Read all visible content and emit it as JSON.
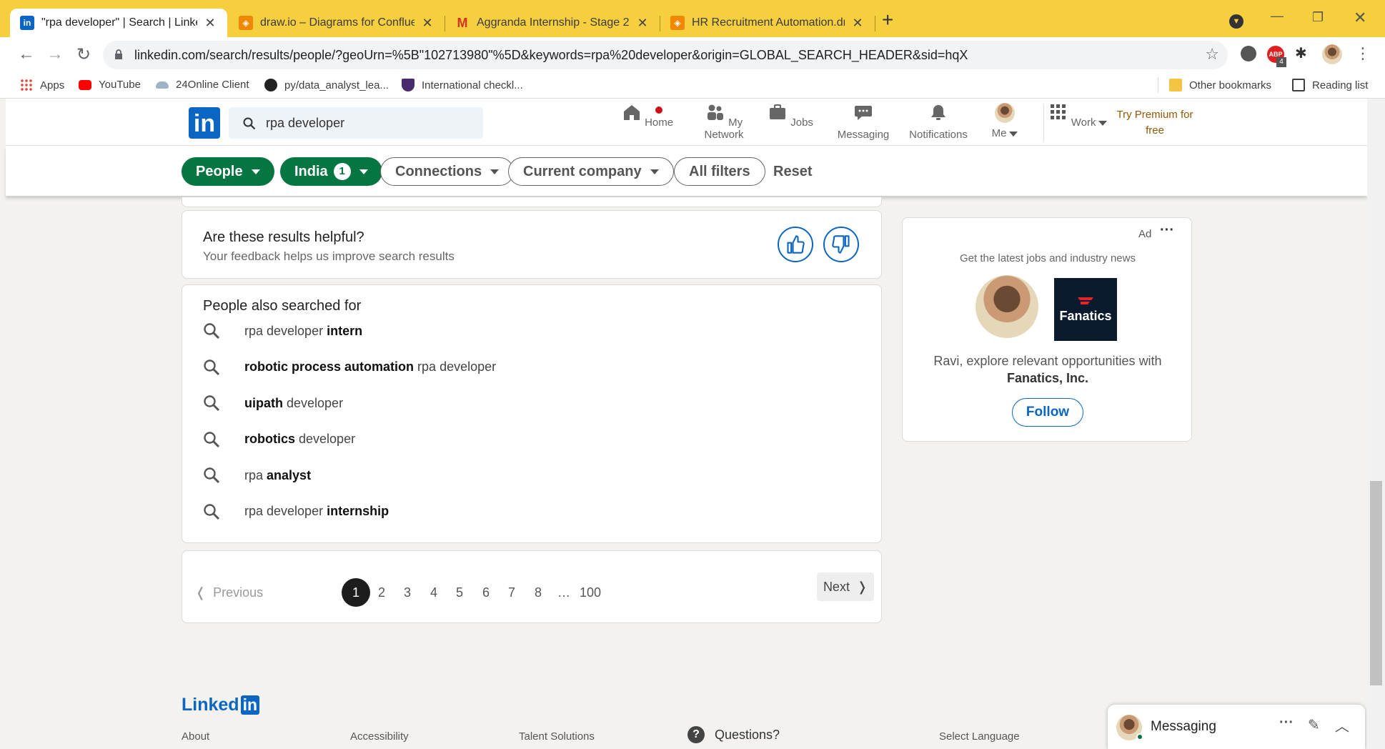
{
  "browser": {
    "tabs": [
      {
        "title": "\"rpa developer\" | Search | LinkedIn",
        "icon": "linkedin-icon",
        "active": true
      },
      {
        "title": "draw.io – Diagrams for Confluence",
        "icon": "drawio-icon",
        "active": false
      },
      {
        "title": "Aggranda Internship - Stage 2 - ",
        "icon": "gmail-icon",
        "active": false
      },
      {
        "title": "HR Recruitment Automation.drawio",
        "icon": "drawio-icon",
        "active": false
      }
    ],
    "url": "linkedin.com/search/results/people/?geoUrn=%5B\"102713980\"%5D&keywords=rpa%20developer&origin=GLOBAL_SEARCH_HEADER&sid=hqX",
    "bookmarks": [
      "Apps",
      "YouTube",
      "24Online Client",
      "py/data_analyst_lea...",
      "International checkl..."
    ],
    "other_bookmarks": "Other bookmarks",
    "reading_list": "Reading list",
    "abp_count": "4"
  },
  "header": {
    "search_value": "rpa developer",
    "nav": [
      "Home",
      "My Network",
      "Jobs",
      "Messaging",
      "Notifications",
      "Me",
      "Work"
    ],
    "premium": "Try Premium for free"
  },
  "filters": {
    "people": "People",
    "india": "India",
    "india_count": "1",
    "connections": "Connections",
    "current_company": "Current company",
    "all_filters": "All filters",
    "reset": "Reset"
  },
  "feedback": {
    "title": "Are these results helpful?",
    "subtitle": "Your feedback helps us improve search results"
  },
  "also_searched": {
    "title": "People also searched for",
    "items": [
      {
        "normal_before": "rpa developer ",
        "bold": "intern",
        "normal_after": ""
      },
      {
        "normal_before": "",
        "bold": "robotic process automation",
        "normal_after": " rpa developer"
      },
      {
        "normal_before": "",
        "bold": "uipath",
        "normal_after": " developer"
      },
      {
        "normal_before": "",
        "bold": "robotics",
        "normal_after": " developer"
      },
      {
        "normal_before": "rpa ",
        "bold": "analyst",
        "normal_after": ""
      },
      {
        "normal_before": "rpa developer ",
        "bold": "internship",
        "normal_after": ""
      }
    ]
  },
  "pagination": {
    "previous": "Previous",
    "next": "Next",
    "pages": [
      "1",
      "2",
      "3",
      "4",
      "5",
      "6",
      "7",
      "8",
      "…",
      "100"
    ],
    "current": "1"
  },
  "ad": {
    "label": "Ad",
    "tagline": "Get the latest jobs and industry news",
    "brand": "Fanatics",
    "message": "Ravi, explore relevant opportunities with",
    "company": "Fanatics, Inc.",
    "follow": "Follow"
  },
  "footer": {
    "brand": "Linked",
    "links": [
      "About",
      "Accessibility",
      "Talent Solutions"
    ],
    "questions": "Questions?",
    "select_language": "Select Language"
  },
  "messaging": {
    "label": "Messaging"
  },
  "colors": {
    "linkedin_blue": "#0a66c2",
    "filter_green": "#057642",
    "chrome_yellow": "#f5cf3d",
    "premium": "#915907"
  }
}
